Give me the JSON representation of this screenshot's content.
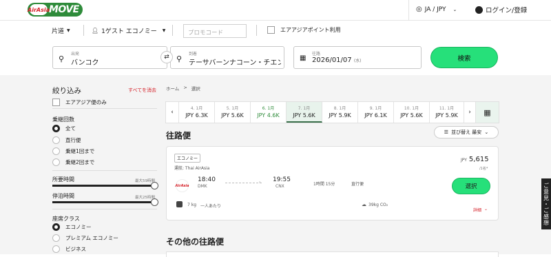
{
  "header": {
    "logo_brand": "AirAsia",
    "logo_word": "MOVE",
    "lang_label": "JA / JPY",
    "login_label": "ログイン/登録"
  },
  "search_options": {
    "trip_type": "片道",
    "guests": "1ゲスト エコノミー",
    "promo_placeholder": "プロモコード",
    "points_label": "エアアジアポイント利用"
  },
  "search_fields": {
    "origin_label": "出発",
    "origin_value": "バンコク",
    "dest_label": "到着",
    "dest_value": "テーサバーンナコーン・チエンマイ",
    "date_label": "往路",
    "date_value": "2026/01/07",
    "date_weekday": "(水)",
    "search_button": "検索"
  },
  "filters": {
    "title": "絞り込み",
    "clear": "すべてを消去",
    "airasia_only": "エアアジア便のみ",
    "stops_title": "乗継回数",
    "stops": [
      "全て",
      "直行便",
      "乗継1回まで",
      "乗継2回まで"
    ],
    "duration_title": "所要時間",
    "duration_max": "最大59時間",
    "layover_title": "停泊時間",
    "layover_max": "最大25時間",
    "class_title": "座席クラス",
    "classes": [
      "エコノミー",
      "プレミアム エコノミー",
      "ビジネス"
    ]
  },
  "breadcrumb": {
    "home": "ホーム",
    "sep": ">",
    "current": "選択"
  },
  "dates": [
    {
      "day": "4. 1月",
      "price": "JPY 6.3K"
    },
    {
      "day": "5. 1月",
      "price": "JPY 5.6K"
    },
    {
      "day": "6. 1月",
      "price": "JPY 4.6K"
    },
    {
      "day": "7. 1月",
      "price": "JPY 5.6K"
    },
    {
      "day": "8. 1月",
      "price": "JPY 5.9K"
    },
    {
      "day": "9. 1月",
      "price": "JPY 6.1K"
    },
    {
      "day": "10. 1月",
      "price": "JPY 5.6K"
    },
    {
      "day": "11. 1月",
      "price": "JPY 5.9K"
    }
  ],
  "results": {
    "heading": "往路便",
    "sort_label": "並び替え 最安",
    "other_heading": "その他の往路便"
  },
  "flight": {
    "fare_class": "エコノミー",
    "operated_by": "運航: Thai AirAsia",
    "dep_time": "18:40",
    "dep_code": "DMK",
    "arr_time": "19:55",
    "arr_code": "CNX",
    "duration": "1時間 15分",
    "stops": "直行便",
    "price_currency": "JPY",
    "price_value": "5,615",
    "price_unit": "/1名*",
    "select_button": "選択",
    "baggage": "7 kg",
    "per_person": "一人あたり",
    "co2": "39kg CO₂",
    "details": "詳細"
  },
  "feedback_tab": "ご意見・ご感想",
  "colors": {
    "brand_green": "#2e8b3a",
    "accent_green": "#26e07a",
    "cheap_green": "#2e8b3a",
    "airasia_red": "#d51f27"
  }
}
